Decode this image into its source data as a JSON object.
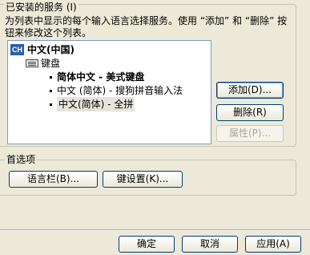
{
  "installed_services": {
    "title": "已安装的服务 (I)",
    "description": "为列表中显示的每个输入语言选择服务。使用 “添加” 和 “删除” 按钮来修改这个列表。",
    "language": {
      "badge": "CH",
      "label": "中文(中国)"
    },
    "keyboard_label": "键盘",
    "services": [
      "简体中文 - 美式键盘",
      "中文 (简体) - 搜狗拼音输入法",
      "中文(简体) - 全拼"
    ],
    "buttons": {
      "add": "添加(D)...",
      "remove": "删除(R)",
      "properties": "属性(P)..."
    }
  },
  "preferences": {
    "title": "首选项",
    "language_bar": "语言栏(B)...",
    "key_settings": "键设置(K)..."
  },
  "dialog_buttons": {
    "ok": "确定",
    "cancel": "取消",
    "apply": "应用(A)"
  }
}
